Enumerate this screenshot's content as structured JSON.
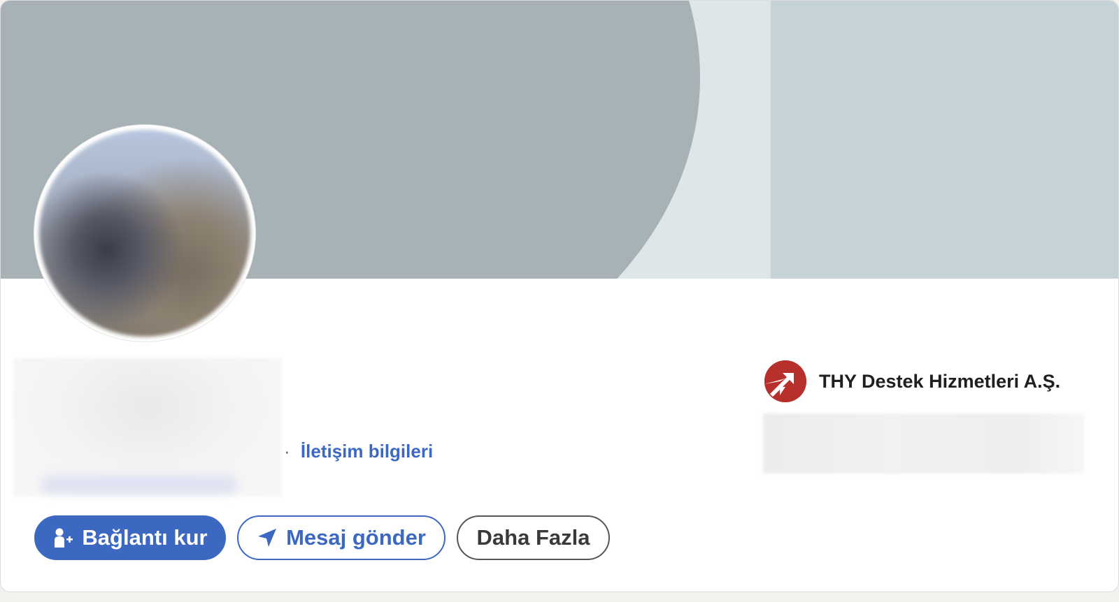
{
  "profile": {
    "contact_separator": "·",
    "contact_link": "İletişim bilgileri"
  },
  "experience": {
    "company_name": "THY Destek Hizmetleri A.Ş.",
    "company_logo_color": "#b7302c"
  },
  "actions": {
    "connect_label": "Bağlantı kur",
    "connect_icon": "add-person-icon",
    "message_label": "Mesaj gönder",
    "message_icon": "send-arrow-icon",
    "more_label": "Daha Fazla"
  },
  "colors": {
    "brand_blue": "#3d68c2",
    "banner_gray": "#a6b2b5",
    "banner_light": "#c5d3d6"
  }
}
